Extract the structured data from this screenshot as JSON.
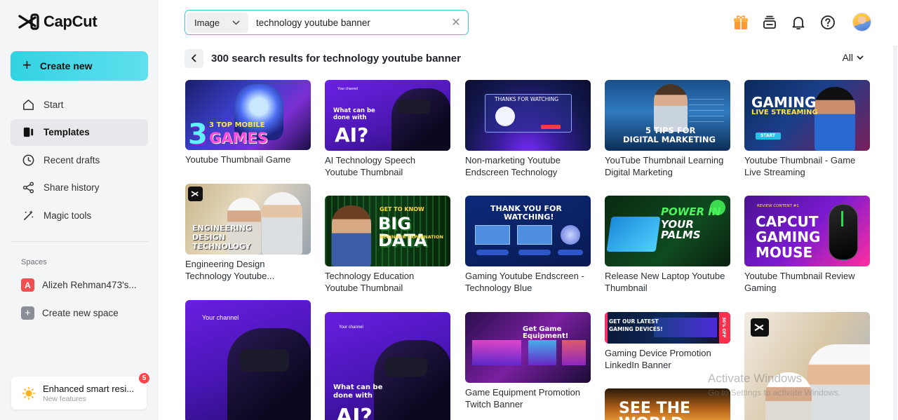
{
  "app": {
    "name": "CapCut"
  },
  "sidebar": {
    "create_label": "Create new",
    "items": [
      {
        "label": "Start",
        "icon": "home-icon"
      },
      {
        "label": "Templates",
        "icon": "templates-icon"
      },
      {
        "label": "Recent drafts",
        "icon": "clock-icon"
      },
      {
        "label": "Share history",
        "icon": "share-icon"
      },
      {
        "label": "Magic tools",
        "icon": "magic-wand-icon"
      }
    ],
    "spaces_title": "Spaces",
    "space_name": "Alizeh Rehman473's...",
    "space_initial": "A",
    "create_space_label": "Create new space",
    "promo_title": "Enhanced smart resi...",
    "promo_sub": "New features",
    "promo_badge": "5"
  },
  "search": {
    "type_label": "Image",
    "query": "technology youtube banner",
    "clear_label": "✕"
  },
  "results": {
    "summary": "300 search results for technology youtube banner",
    "filter_label": "All"
  },
  "cards": [
    {
      "line1": "Youtube Thumbnail Game",
      "line2": "",
      "t1": "3 TOP MOBILE",
      "t2": "GAMES"
    },
    {
      "line1": "AI Technology Speech",
      "line2": "Youtube Thumbnail",
      "t1": "Your channel",
      "t2": "What can be done with",
      "t3": "AI?"
    },
    {
      "line1": "Non-marketing Youtube",
      "line2": "Endscreen Technology",
      "t1": "THANKS FOR WATCHING"
    },
    {
      "line1": "YouTube Thumbnail Learning",
      "line2": "Digital Marketing",
      "t1": "5 TIPS FOR",
      "t2": "DIGITAL MARKETING"
    },
    {
      "line1": "Youtube Thumbnail - Game",
      "line2": "Live Streaming",
      "t1": "GAMING",
      "t2": "LIVE STREAMING",
      "t3": "START"
    },
    {
      "line1": "Engineering Design",
      "line2": "Technology Youtube...",
      "t1": "ENGINEERING",
      "t2": "DESIGN",
      "t3": "TECHNOLOGY"
    },
    {
      "line1": "Technology Education",
      "line2": "Youtube Thumbnail",
      "t1": "GET TO KNOW",
      "t2": "BIG DATA",
      "t3": "BEGINNER EXPLANATION"
    },
    {
      "line1": "Gaming Youtube Endscreen -",
      "line2": "Technology Blue",
      "t1": "THANK YOU FOR",
      "t2": "WATCHING!"
    },
    {
      "line1": "Release New Laptop Youtube",
      "line2": "Thumbnail",
      "t1": "POWER IN",
      "t2": "YOUR PALMS"
    },
    {
      "line1": "Youtube Thumbnail Review",
      "line2": "Gaming",
      "t1": "REVIEW CONTENT #1",
      "t2": "CAPCUT",
      "t3": "GAMING",
      "t4": "MOUSE"
    },
    {
      "line1": "",
      "line2": "",
      "t1": "Your channel"
    },
    {
      "line1": "",
      "line2": "",
      "t1": "Your channel",
      "t2": "What can be done with",
      "t3": "AI?"
    },
    {
      "line1": "Game Equipment Promotion",
      "line2": "Twitch Banner",
      "t1": "Get Game Equipment!"
    },
    {
      "line1": "Gaming Device Promotion",
      "line2": "LinkedIn Banner",
      "t1": "GET OUR LATEST",
      "t2": "GAMING DEVICES!",
      "t3": "30% OFF"
    },
    {
      "line1": "",
      "line2": "",
      "t1": "SEE THE WORLD"
    },
    {
      "line1": "",
      "line2": ""
    }
  ],
  "watermark": {
    "title": "Activate Windows",
    "sub": "Go to Settings to activate Windows."
  },
  "colors": {
    "accent": "#3bc6d6",
    "sidebar_bg": "#f4f5f7",
    "badge": "#f5484b"
  }
}
